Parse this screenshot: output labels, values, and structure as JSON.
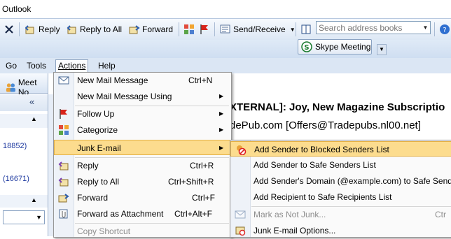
{
  "window": {
    "title": "Outlook"
  },
  "toolbar": {
    "reply": "Reply",
    "reply_all": "Reply to All",
    "forward": "Forward",
    "send_receive": "Send/Receive",
    "search_placeholder": "Search address books"
  },
  "skype": {
    "label": "Skype Meeting"
  },
  "menubar": {
    "go": "Go",
    "tools": "Tools",
    "actions": "Actions",
    "help": "Help"
  },
  "leftpane": {
    "meet_now": "Meet No",
    "count1": "18852)",
    "count2": "(16671)"
  },
  "reading": {
    "subject": "XTERNAL]: Joy, New Magazine Subscriptio",
    "from": "dePub.com [Offers@Tradepubs.nl00.net]"
  },
  "actions_menu": {
    "items": [
      {
        "label": "New Mail Message",
        "shortcut": "Ctrl+N"
      },
      {
        "label": "New Mail Message Using",
        "shortcut": ""
      },
      {
        "label": "Follow Up",
        "shortcut": ""
      },
      {
        "label": "Categorize",
        "shortcut": ""
      },
      {
        "label": "Junk E-mail",
        "shortcut": ""
      },
      {
        "label": "Reply",
        "shortcut": "Ctrl+R"
      },
      {
        "label": "Reply to All",
        "shortcut": "Ctrl+Shift+R"
      },
      {
        "label": "Forward",
        "shortcut": "Ctrl+F"
      },
      {
        "label": "Forward as Attachment",
        "shortcut": "Ctrl+Alt+F"
      },
      {
        "label": "Copy Shortcut",
        "shortcut": ""
      }
    ]
  },
  "junk_submenu": {
    "items": [
      {
        "label": "Add Sender to Blocked Senders List"
      },
      {
        "label": "Add Sender to Safe Senders List"
      },
      {
        "label": "Add Sender's Domain (@example.com) to Safe Sende"
      },
      {
        "label": "Add Recipient to Safe Recipients List"
      },
      {
        "label": "Mark as Not Junk...",
        "shortcut": "Ctr"
      },
      {
        "label": "Junk E-mail Options..."
      }
    ]
  },
  "colors": {
    "highlight": "#fcdc8e",
    "highlight_border": "#e4b044",
    "toolbar": "#dde8f5"
  }
}
